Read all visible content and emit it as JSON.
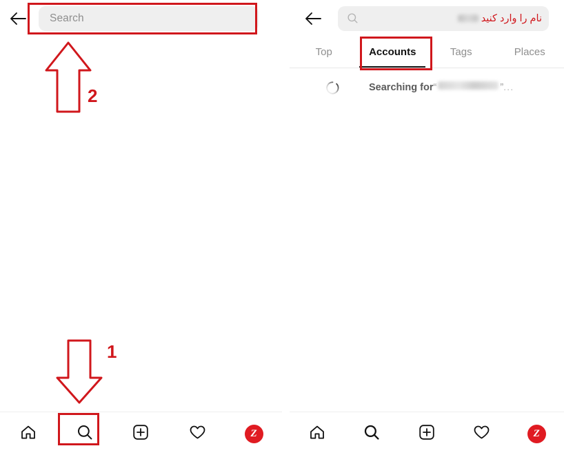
{
  "meta": {
    "accent_red": "#d0171c",
    "brand_red": "#e01b22",
    "field_bg": "#efefef",
    "muted_text": "#8e8e8e"
  },
  "left_screen": {
    "name": "search-empty-state",
    "topbar": {
      "back_icon": "arrow-left-icon",
      "search_placeholder": "Search"
    },
    "bottom_nav": [
      {
        "name": "home",
        "icon": "home-icon",
        "label": "Home"
      },
      {
        "name": "search",
        "icon": "search-icon",
        "label": "Search"
      },
      {
        "name": "create",
        "icon": "plus-square-icon",
        "label": "Create"
      },
      {
        "name": "activity",
        "icon": "heart-icon",
        "label": "Activity"
      },
      {
        "name": "profile",
        "icon": "avatar-z-icon",
        "label": "Z"
      }
    ],
    "annotations": [
      {
        "name": "step-2-arrow",
        "shape": "arrow-up",
        "number": "2"
      },
      {
        "name": "step-1-arrow",
        "shape": "arrow-down",
        "number": "1"
      }
    ]
  },
  "right_screen": {
    "name": "search-results-accounts",
    "topbar": {
      "back_icon": "arrow-left-icon",
      "search_icon": "search-icon",
      "search_value": "",
      "red_note_rtl": "نام را وارد کنید"
    },
    "tabs": [
      {
        "label": "Top",
        "active": false
      },
      {
        "label": "Accounts",
        "active": true
      },
      {
        "label": "Tags",
        "active": false
      },
      {
        "label": "Places",
        "active": false
      }
    ],
    "status": {
      "spinner_icon": "loading-spinner-icon",
      "searching_prefix": "Searching for",
      "quote_open": "“",
      "quote_close": "”",
      "ellipsis": "..."
    },
    "bottom_nav": [
      {
        "name": "home",
        "icon": "home-icon",
        "label": "Home"
      },
      {
        "name": "search",
        "icon": "search-icon",
        "label": "Search"
      },
      {
        "name": "create",
        "icon": "plus-square-icon",
        "label": "Create"
      },
      {
        "name": "activity",
        "icon": "heart-icon",
        "label": "Activity"
      },
      {
        "name": "profile",
        "icon": "avatar-z-icon",
        "label": "Z"
      }
    ]
  }
}
